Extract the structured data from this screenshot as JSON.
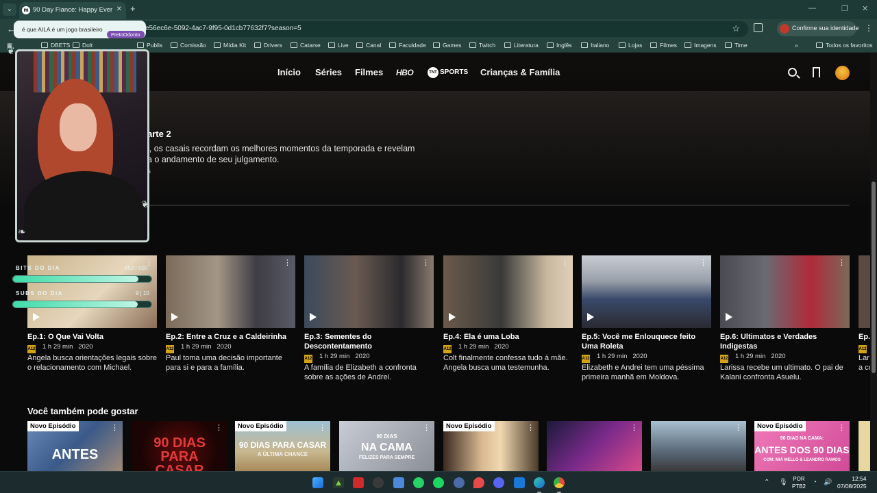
{
  "browser": {
    "tab_switcher": "⌄",
    "tab_title": "90 Day Fiance: Happy Ever Af...",
    "tab_close": "✕",
    "new_tab": "+",
    "url": "e56ec6e-5092-4ac7-9f95-0d1cb77632f7?season=5",
    "identity_label": "Confirme sua identidade",
    "bookmarks": [
      "DBETS",
      "Dolt",
      "Publis",
      "Comissão",
      "Mídia Kit",
      "Drivers",
      "Catarse",
      "Live",
      "Canal",
      "Faculdade",
      "Games",
      "Twitch",
      "Literatura",
      "Inglês",
      "Italiano",
      "Lojas",
      "Filmes",
      "Imagens",
      "Time"
    ],
    "bookmarks_overflow": "»",
    "all_favorites": "Todos os favoritos"
  },
  "site": {
    "nav": [
      "Início",
      "Séries",
      "Filmes"
    ],
    "hbo": "HBO",
    "tnt_badge": "TNT",
    "tnt": "SPORTS",
    "nav_kids": "Crianças & Família",
    "hero_title": "arte 2",
    "hero_desc": "l, os casais recordam os melhores momentos da temporada e revelam\na o andamento de seu julgamento.",
    "hero_meta": "s"
  },
  "episodes": [
    {
      "title": "Ep.1: O Que Vai Volta",
      "rating": "A12",
      "duration": "1 h 29 min",
      "year": "2020",
      "desc": "Angela busca orientações legais sobre o relacionamento com Michael."
    },
    {
      "title": "Ep.2: Entre a Cruz e a Caldeirinha",
      "rating": "A12",
      "duration": "1 h 29 min",
      "year": "2020",
      "desc": "Paul toma uma decisão importante para si e para a família."
    },
    {
      "title": "Ep.3: Sementes do Descontentamento",
      "rating": "A12",
      "duration": "1 h 29 min",
      "year": "2020",
      "desc": "A família de Elizabeth a confronta sobre as ações de Andrei."
    },
    {
      "title": "Ep.4: Ela é uma Loba",
      "rating": "A12",
      "duration": "1 h 29 min",
      "year": "2020",
      "desc": "Colt finalmente confessa tudo à mãe. Angela busca uma testemunha."
    },
    {
      "title": "Ep.5: Você me Enlouquece feito Uma Roleta",
      "rating": "A12",
      "duration": "1 h 29 min",
      "year": "2020",
      "desc": "Elizabeth e Andrei tem uma péssima primeira manhã em Moldova."
    },
    {
      "title": "Ep.6: Ultimatos e Verdades Indigestas",
      "rating": "A12",
      "duration": "1 h 29 min",
      "year": "2020",
      "desc": "Larissa recebe um ultimato. O pai de Kalani confronta Asuelu."
    },
    {
      "title": "Ep.",
      "rating": "A12",
      "duration": "",
      "year": "",
      "desc": "Lar\na cu"
    }
  ],
  "recommendations": {
    "title": "Você também pode gostar",
    "new_badge": "Novo Episódio",
    "items": [
      {
        "badge": "Novo Episódio",
        "label": "ANTES"
      },
      {
        "badge": "",
        "label": "90 DIAS PARA CASAR"
      },
      {
        "badge": "Novo Episódio",
        "label": "90 DIAS PARA CASAR"
      },
      {
        "badge": "",
        "label": "NA CAMA"
      },
      {
        "badge": "Novo Episódio",
        "label": ""
      },
      {
        "badge": "",
        "label": ""
      },
      {
        "badge": "",
        "label": ""
      },
      {
        "badge": "Novo Episódio",
        "label": "ANTES DOS 90 DIAS"
      }
    ]
  },
  "stream_overlay": {
    "chat_message": "é que AILA é um jogo brasileiro",
    "chat_user": "PretoOdonto",
    "bits_label": "BITS DO DIA",
    "bits_value": "453 | 500",
    "bits_fraction": 0.906,
    "subs_label": "SUBS DO DIA",
    "subs_value": "9 | 10",
    "subs_fraction": 0.9
  },
  "taskbar": {
    "lang": "POR\nPTB2",
    "time": "12:54",
    "date": "07/08/2025"
  },
  "colors": {
    "accent_rating": "#d2a315",
    "browser_frame": "#25423d",
    "overlay_bar": "#3fdba8"
  }
}
